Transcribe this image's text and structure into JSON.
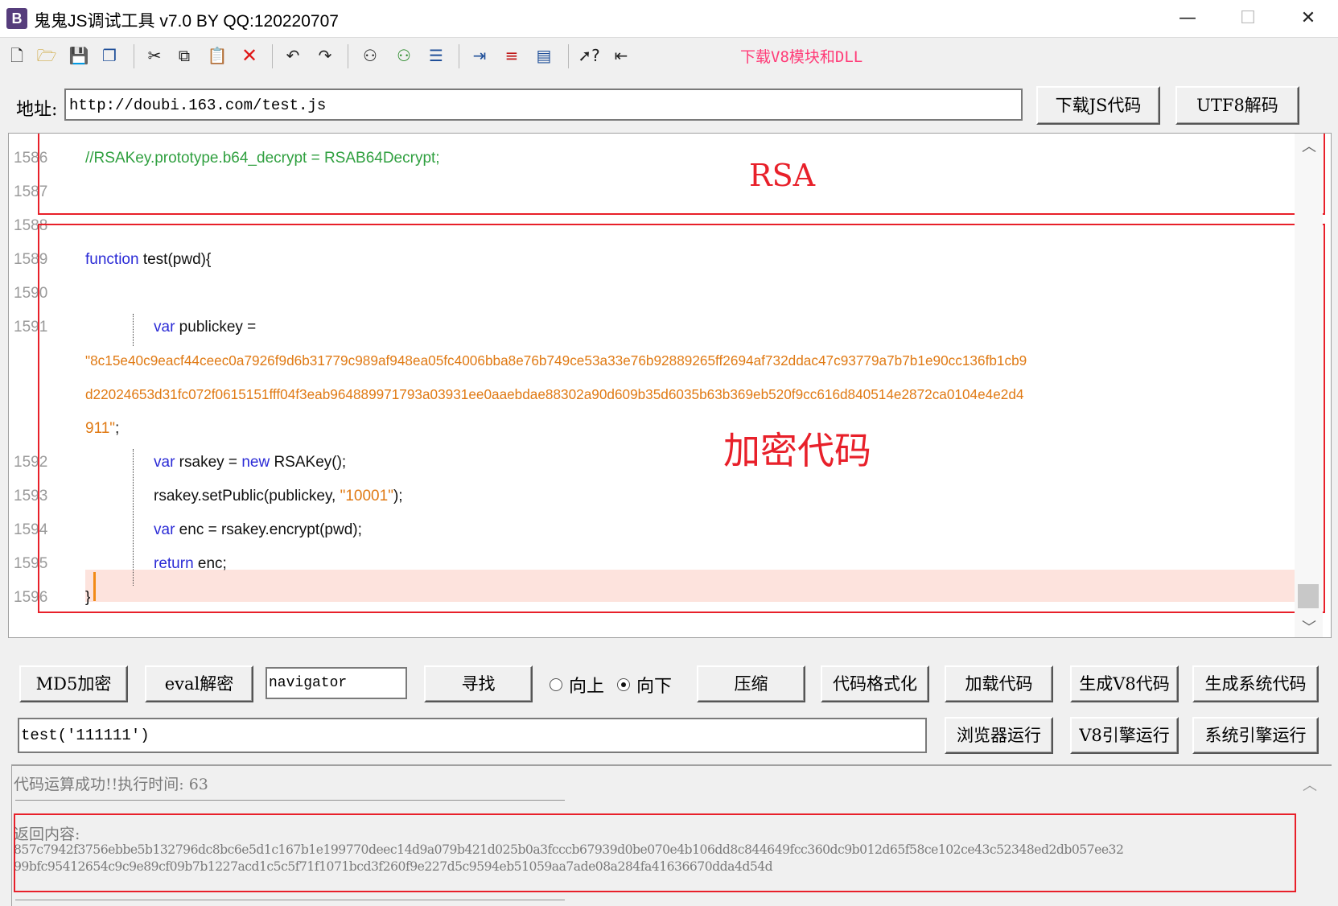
{
  "window": {
    "app_icon_letter": "B",
    "title": "鬼鬼JS调试工具 v7.0 BY QQ:120220707",
    "minimize_glyph": "—",
    "maximize_glyph": "☐",
    "close_glyph": "✕"
  },
  "toolbar": {
    "download_link": "下载V8模块和DLL",
    "icons": [
      "new-file-icon",
      "open-folder-icon",
      "save-icon",
      "save-all-icon",
      "cut-icon",
      "copy-icon",
      "paste-icon",
      "delete-icon",
      "undo-icon",
      "redo-icon",
      "find-icon",
      "find-next-icon",
      "insert-list-icon",
      "indent-icon",
      "numbered-list-icon",
      "window-icon",
      "help-cursor-icon",
      "exit-icon"
    ]
  },
  "address": {
    "label": "地址:",
    "value": "http://doubi.163.com/test.js",
    "download_button": "下载JS代码",
    "utf8_button": "UTF8解码"
  },
  "editor": {
    "line_numbers": [
      "1586",
      "1587",
      "1588",
      "1589",
      "1590",
      "1591",
      "1592",
      "1593",
      "1594",
      "1595",
      "1596"
    ],
    "lines": {
      "l1586": "//RSAKey.prototype.b64_decrypt = RSAB64Decrypt;",
      "l1589_kw": "function",
      "l1589_rest": " test(pwd){",
      "l1591_kw": "var",
      "l1591_rest": " publickey =",
      "l1591_str_1": "\"8c15e40c9eacf44ceec0a7926f9d6b31779c989af948ea05fc4006bba8e76b749ce53a33e76b92889265ff2694af732ddac47c93779a7b7b1e90cc136fb1cb9",
      "l1591_str_2": "d22024653d31fc072f0615151fff04f3eab964889971793a03931ee0aaebdae88302a90d609b35d6035b63b369eb520f9cc616d840514e2872ca0104e4e2d4",
      "l1591_str_3": "911\"",
      "l1591_end": ";",
      "l1592_kw1": "var",
      "l1592_mid": " rsakey = ",
      "l1592_kw2": "new",
      "l1592_rest": " RSAKey();",
      "l1593_pre": "rsakey.setPublic(publickey, ",
      "l1593_str": "\"10001\"",
      "l1593_end": ");",
      "l1594_kw": "var",
      "l1594_rest": " enc = rsakey.encrypt(pwd);",
      "l1595_kw": "return",
      "l1595_rest": " enc;",
      "l1596": "}"
    },
    "annotation_rsa": "RSA",
    "annotation_encrypt": "加密代码"
  },
  "controls": {
    "md5_button": "MD5加密",
    "eval_button": "eval解密",
    "search_value": "navigator",
    "find_button": "寻找",
    "radio_up": "向上",
    "radio_down": "向下",
    "radio_selected": "向下",
    "compress_button": "压缩",
    "format_button": "代码格式化",
    "load_button": "加载代码",
    "gen_v8_button": "生成V8代码",
    "gen_sys_button": "生成系统代码",
    "exec_input": "test('111111')",
    "browser_run_button": "浏览器运行",
    "v8_run_button": "V8引擎运行",
    "sys_run_button": "系统引擎运行"
  },
  "output": {
    "status": "代码运算成功!!执行时间: 63",
    "return_label": "返回内容:",
    "return_line_1": "857c7942f3756ebbe5b132796dc8bc6e5d1c167b1e199770deec14d9a079b421d025b0a3fcccb67939d0be070e4b106dd8c844649fcc360dc9b012d65f58ce102ce43c52348ed2db057ee32",
    "return_line_2": "99bfc95412654c9c9e89cf09b7b1227acd1c5c5f71f1071bcd3f260f9e227d5c9594eb51059aa7ade08a284fa41636670dda4d54d"
  },
  "colors": {
    "keyword": "#2b2bd6",
    "string": "#e07a14",
    "comment": "#30a040",
    "annotation_red": "#e8202a",
    "current_line": "#fde3dd",
    "link_pink": "#ff3c78"
  }
}
